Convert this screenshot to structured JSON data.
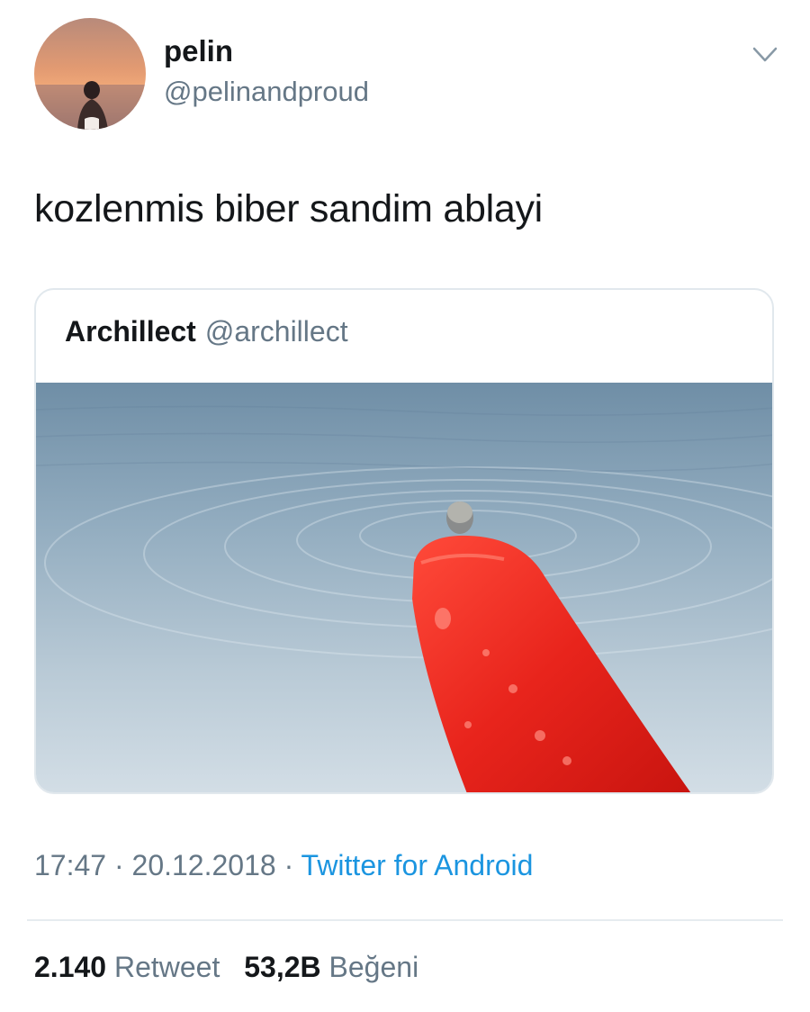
{
  "tweet": {
    "author_name": "pelin",
    "author_handle": "@pelinandproud",
    "text": "kozlenmis biber sandim ablayi",
    "time": "17:47",
    "date": "20.12.2018",
    "source": "Twitter for Android",
    "separator": "·"
  },
  "quoted": {
    "author_name": "Archillect",
    "author_handle": "@archillect"
  },
  "stats": {
    "retweets_count": "2.140",
    "retweets_label": "Retweet",
    "likes_count": "53,2B",
    "likes_label": "Beğeni"
  },
  "icons": {
    "menu": "chevron-down-icon"
  },
  "colors": {
    "text": "#14171a",
    "secondary": "#657786",
    "link": "#1b95e0",
    "border": "#e1e8ed"
  }
}
